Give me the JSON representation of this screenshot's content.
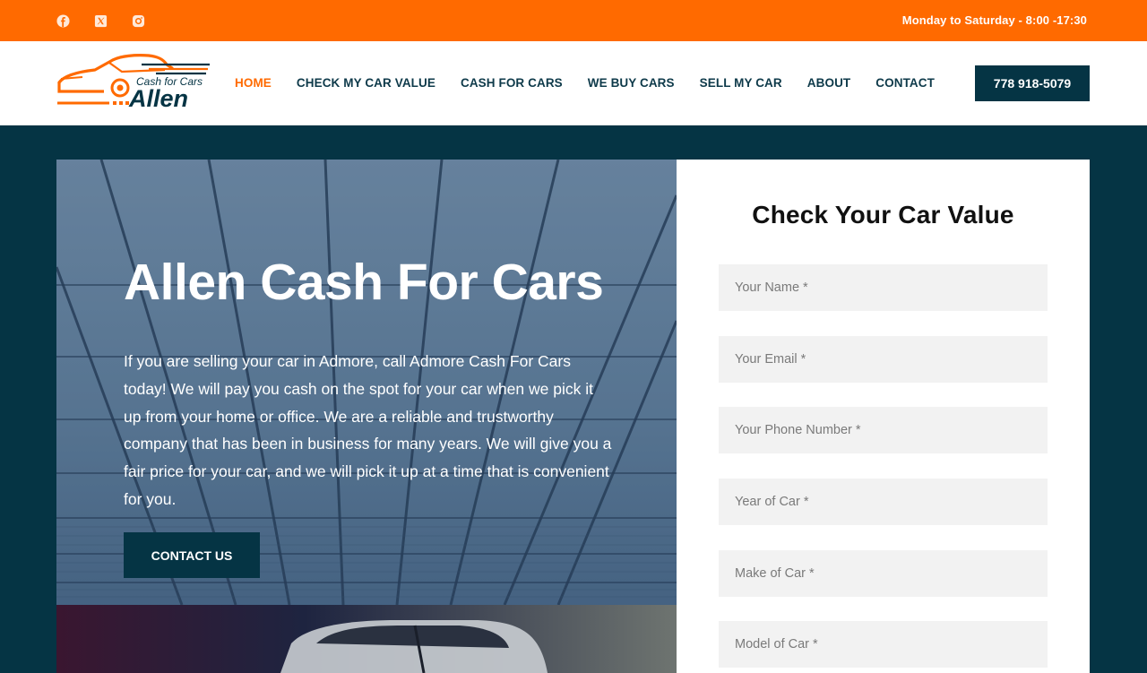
{
  "topbar": {
    "social": [
      {
        "icon": "facebook-icon"
      },
      {
        "icon": "x-twitter-icon"
      },
      {
        "icon": "instagram-icon"
      }
    ],
    "hours": "Monday to Saturday - 8:00 -17:30",
    "background_color": "#ff6a00"
  },
  "header": {
    "logo": {
      "tagline": "Cash for Cars",
      "name": "Allen"
    },
    "nav": [
      {
        "label": "HOME",
        "active": true
      },
      {
        "label": "CHECK MY CAR VALUE",
        "active": false
      },
      {
        "label": "CASH FOR CARS",
        "active": false
      },
      {
        "label": "WE BUY CARS",
        "active": false
      },
      {
        "label": "SELL MY CAR",
        "active": false
      },
      {
        "label": "ABOUT",
        "active": false
      },
      {
        "label": "CONTACT",
        "active": false
      }
    ],
    "phone": "778 918-5079"
  },
  "hero": {
    "title": "Allen Cash For Cars",
    "text": "If you are selling your car in Admore, call Admore Cash For Cars today! We will pay you cash on the spot for your car when we pick it up from your home or office. We are a reliable and trustworthy company that has been in business for many years. We will give you a fair price for your car, and we will pick it up at a time that is convenient for you.",
    "cta": "CONTACT US"
  },
  "form": {
    "title": "Check Your Car Value",
    "fields": [
      {
        "placeholder": "Your Name *",
        "value": ""
      },
      {
        "placeholder": "Your Email *",
        "value": ""
      },
      {
        "placeholder": "Your Phone Number *",
        "value": ""
      },
      {
        "placeholder": "Year of Car *",
        "value": ""
      },
      {
        "placeholder": "Make of Car *",
        "value": ""
      },
      {
        "placeholder": "Model of Car *",
        "value": ""
      }
    ]
  },
  "colors": {
    "accent": "#ff6a00",
    "dark": "#053444",
    "nav_text": "#0e3a4a"
  }
}
